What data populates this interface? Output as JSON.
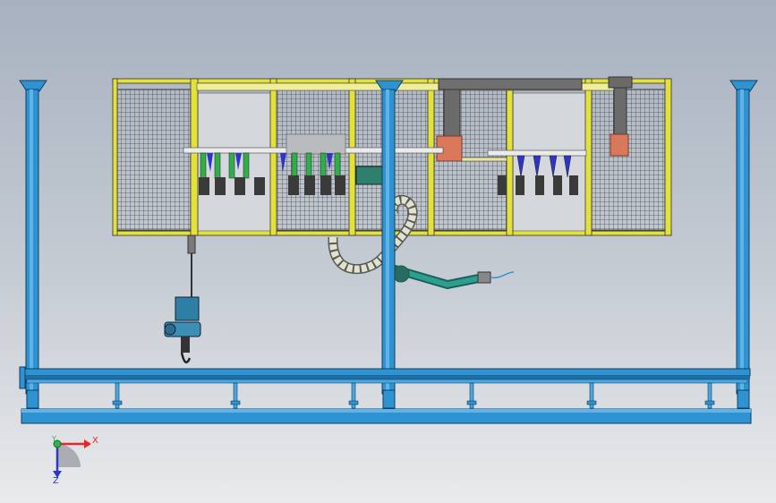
{
  "triad": {
    "x_label": "X",
    "y_label": "Y",
    "z_label": "Z",
    "x_color": "#e8262a",
    "y_color": "#2fb34a",
    "z_color": "#2b38c8"
  },
  "colors": {
    "steel_blue": "#2f93d2",
    "steel_blue_dark": "#14609a",
    "frame_yellow": "#e4e23a",
    "mesh_line": "#4a4a4a",
    "tool_green": "#2fae4a",
    "tool_blue": "#2d34c8",
    "hose": "#d9d9c8",
    "robot_teal": "#1e8f80",
    "copper": "#d9785a",
    "hoist_blue": "#2e7fa5"
  },
  "components": {
    "gantry_columns": 3,
    "fence_panels": 7,
    "hanger_rods": 6
  }
}
